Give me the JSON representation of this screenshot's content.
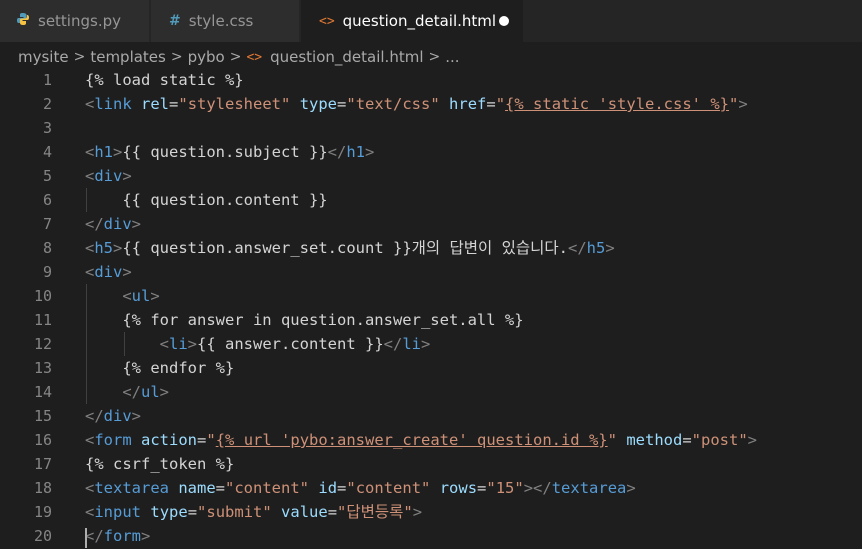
{
  "tabs": [
    {
      "label": "settings.py",
      "icon": "python-icon"
    },
    {
      "label": "style.css",
      "icon": "css-hash-icon",
      "glyph": "#"
    },
    {
      "label": "question_detail.html",
      "icon": "html-icon",
      "glyph": "<>",
      "active": true,
      "modified": true
    }
  ],
  "breadcrumb": {
    "items": [
      "mysite",
      "templates",
      "pybo",
      "question_detail.html",
      "..."
    ],
    "separator": ">"
  },
  "editor": {
    "line_numbers": [
      "1",
      "2",
      "3",
      "4",
      "5",
      "6",
      "7",
      "8",
      "9",
      "10",
      "11",
      "12",
      "13",
      "14",
      "15",
      "16",
      "17",
      "18",
      "19",
      "20"
    ],
    "text": {
      "l1": "{% load static %}",
      "l2_tag": "link",
      "l2_a1": "rel",
      "l2_v1": "\"stylesheet\"",
      "l2_a2": "type",
      "l2_v2": "\"text/css\"",
      "l2_a3": "href",
      "l2_v3q": "\"",
      "l2_v3": "{% static 'style.css' %}",
      "l4_tag": "h1",
      "l4_text": "{{ question.subject }}",
      "l5_tag": "div",
      "l6_text": "{{ question.content }}",
      "l7_tag": "div",
      "l8_tag": "h5",
      "l8_text": "{{ question.answer_set.count }}개의 답변이 있습니다.",
      "l9_tag": "div",
      "l10_tag": "ul",
      "l11": "{% for answer in question.answer_set.all %}",
      "l12_tag": "li",
      "l12_text": "{{ answer.content }}",
      "l13": "{% endfor %}",
      "l14_tag": "ul",
      "l15_tag": "div",
      "l16_tag": "form",
      "l16_a1": "action",
      "l16_v1q": "\"",
      "l16_v1": "{% url 'pybo:answer_create' question.id %}",
      "l16_a2": "method",
      "l16_v2": "\"post\"",
      "l17": "{% csrf_token %}",
      "l18_tag": "textarea",
      "l18_a1": "name",
      "l18_v1": "\"content\"",
      "l18_a2": "id",
      "l18_v2": "\"content\"",
      "l18_a3": "rows",
      "l18_v3": "\"15\"",
      "l19_tag": "input",
      "l19_a1": "type",
      "l19_v1": "\"submit\"",
      "l19_a2": "value",
      "l19_v2": "\"답변등록\"",
      "l20_tag": "form"
    }
  },
  "colors": {
    "background": "#1e1e1e",
    "tag": "#569cd6",
    "attribute": "#9cdcfe",
    "string": "#ce9178",
    "text": "#d4d4d4",
    "line_number": "#858585"
  }
}
